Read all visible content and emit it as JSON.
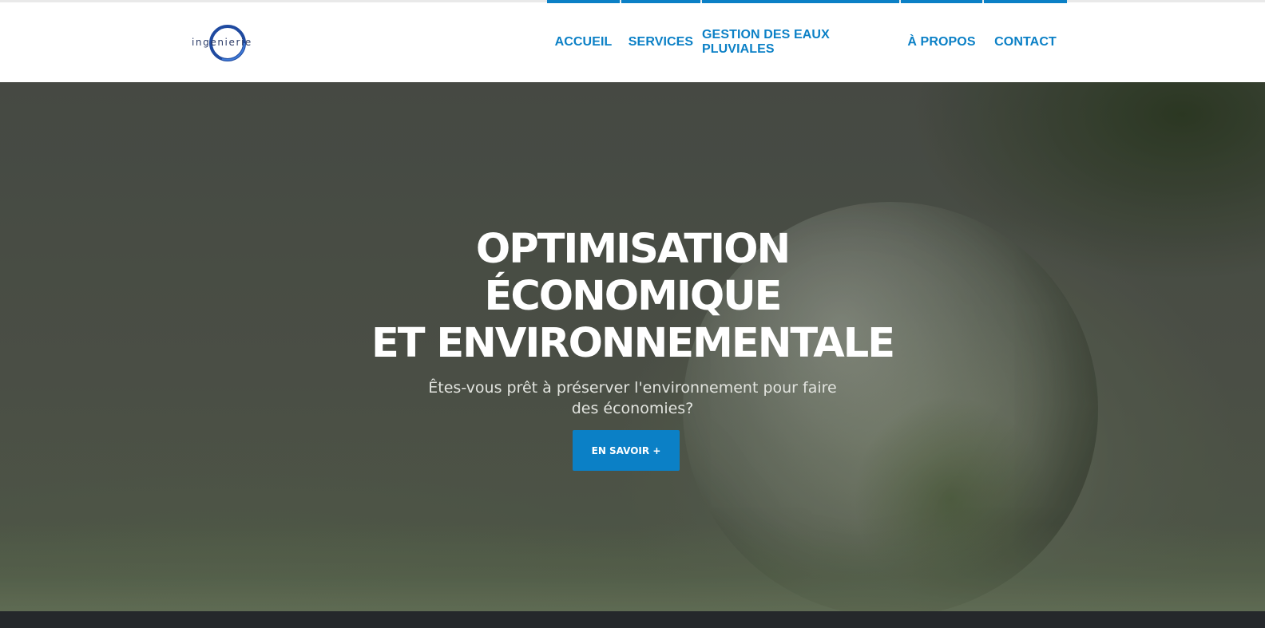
{
  "header": {
    "logo_text": "ingenierie",
    "logo_icon": "ring-logo-icon",
    "nav": [
      {
        "label": "ACCUEIL"
      },
      {
        "label": "SERVICES"
      },
      {
        "label": "GESTION DES EAUX PLUVIALES"
      },
      {
        "label": "À PROPOS"
      },
      {
        "label": "CONTACT"
      }
    ]
  },
  "hero": {
    "title_lines": [
      "OPTIMISATION",
      "ÉCONOMIQUE",
      "ET ENVIRONNEMENTALE"
    ],
    "subtitle": "Êtes-vous prêt à préserver l'environnement pour faire des économies?",
    "button_label": "EN SAVOIR +"
  },
  "colors": {
    "accent": "#0b80c6",
    "header_bg": "#ffffff",
    "footer_bg": "#25282b"
  }
}
